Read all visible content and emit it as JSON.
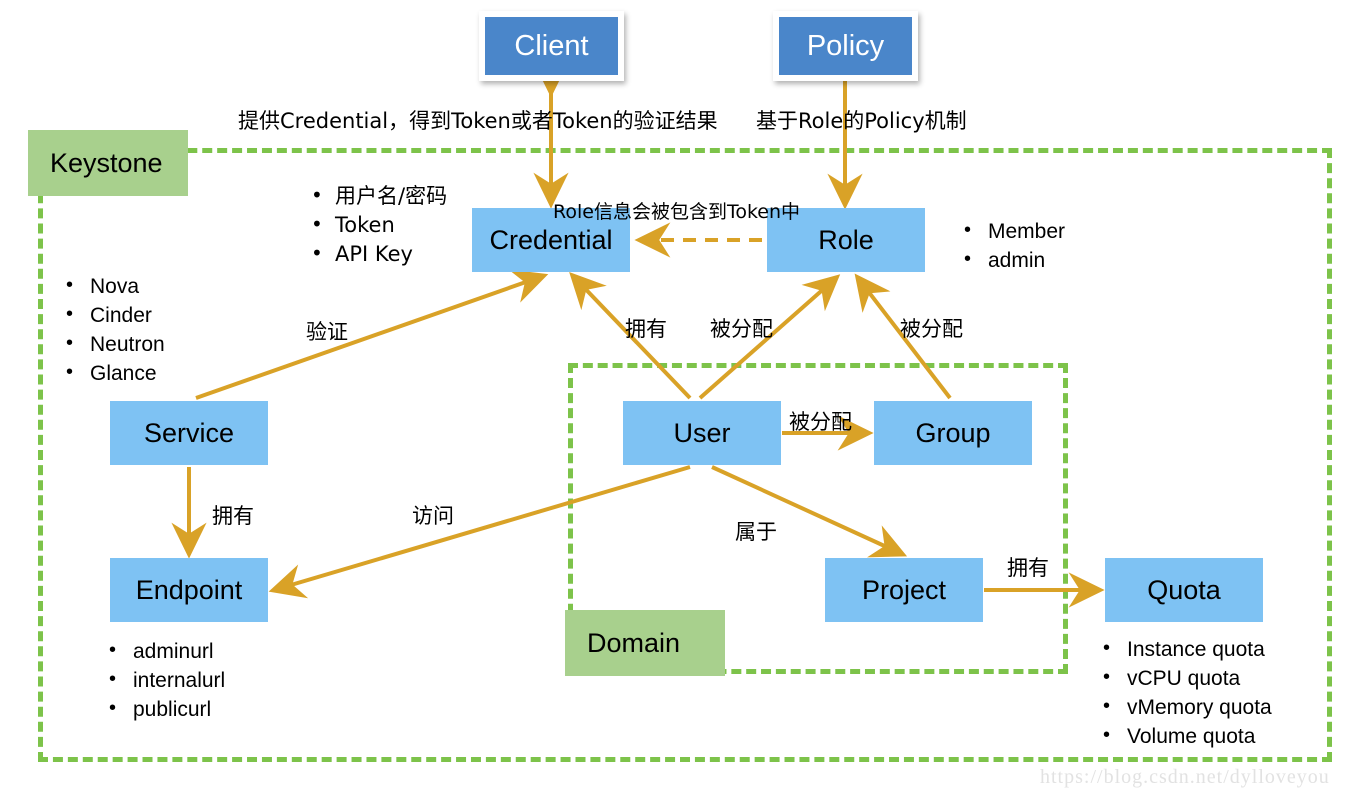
{
  "diagram": {
    "title": "OpenStack Keystone Concept Diagram",
    "colors": {
      "node_light_blue": "#7ec2f3",
      "node_dark_blue": "#4a86ca",
      "group_green_fill": "#a8d08d",
      "group_green_dash": "#7dc34a",
      "arrow_orange": "#d9a227",
      "text_black": "#000000",
      "watermark_gray": "#e2e2e2"
    }
  },
  "nodes": {
    "client": {
      "label": "Client"
    },
    "policy": {
      "label": "Policy"
    },
    "credential": {
      "label": "Credential"
    },
    "role": {
      "label": "Role"
    },
    "service": {
      "label": "Service"
    },
    "user": {
      "label": "User"
    },
    "group": {
      "label": "Group"
    },
    "endpoint": {
      "label": "Endpoint"
    },
    "project": {
      "label": "Project"
    },
    "quota": {
      "label": "Quota"
    }
  },
  "boundaries": {
    "keystone": {
      "label": "Keystone"
    },
    "domain": {
      "label": "Domain"
    }
  },
  "captions": {
    "client_flow": "提供Credential，得到Token或者Token的验证结果",
    "policy_flow": "基于Role的Policy机制",
    "role_token": "Role信息会被包含到Token中"
  },
  "edge_labels": {
    "service_to_credential": "验证",
    "user_to_credential": "拥有",
    "user_to_role": "被分配",
    "group_to_role": "被分配",
    "user_to_group": "被分配",
    "service_to_endpoint": "拥有",
    "user_to_endpoint": "访问",
    "user_to_project": "属于",
    "project_to_quota": "拥有"
  },
  "lists": {
    "credential_items": [
      "用户名/密码",
      "Token",
      "API Key"
    ],
    "service_items": [
      "Nova",
      "Cinder",
      "Neutron",
      "Glance"
    ],
    "role_items": [
      "Member",
      "admin"
    ],
    "endpoint_items": [
      "adminurl",
      "internalurl",
      "publicurl"
    ],
    "quota_items": [
      "Instance quota",
      "vCPU quota",
      "vMemory quota",
      "Volume quota"
    ]
  },
  "watermark": {
    "text": "https://blog.csdn.net/dylloveyou"
  }
}
